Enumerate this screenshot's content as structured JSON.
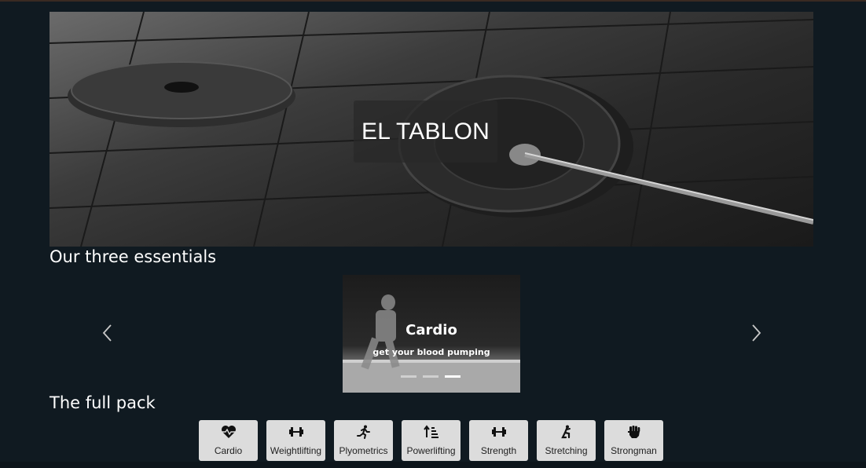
{
  "hero": {
    "title": "EL TABLON"
  },
  "sections": {
    "essentials_title": "Our three essentials",
    "pack_title": "The full pack"
  },
  "carousel": {
    "slide": {
      "title": "Cardio",
      "subtitle": "get your blood pumping"
    },
    "indicators": 3,
    "active_indicator": 3,
    "prev_icon": "chevron-left-icon",
    "next_icon": "chevron-right-icon"
  },
  "pack": {
    "items": [
      {
        "label": "Cardio",
        "icon": "heartbeat-icon"
      },
      {
        "label": "Weightlifting",
        "icon": "dumbbell-icon"
      },
      {
        "label": "Plyometrics",
        "icon": "running-icon"
      },
      {
        "label": "Powerlifting",
        "icon": "sort-amount-up-icon"
      },
      {
        "label": "Strength",
        "icon": "dumbbell-icon"
      },
      {
        "label": "Stretching",
        "icon": "kneeling-icon"
      },
      {
        "label": "Strongman",
        "icon": "fist-icon"
      }
    ]
  },
  "colors": {
    "background": "#101a21",
    "button_bg": "#dcdcdc"
  }
}
